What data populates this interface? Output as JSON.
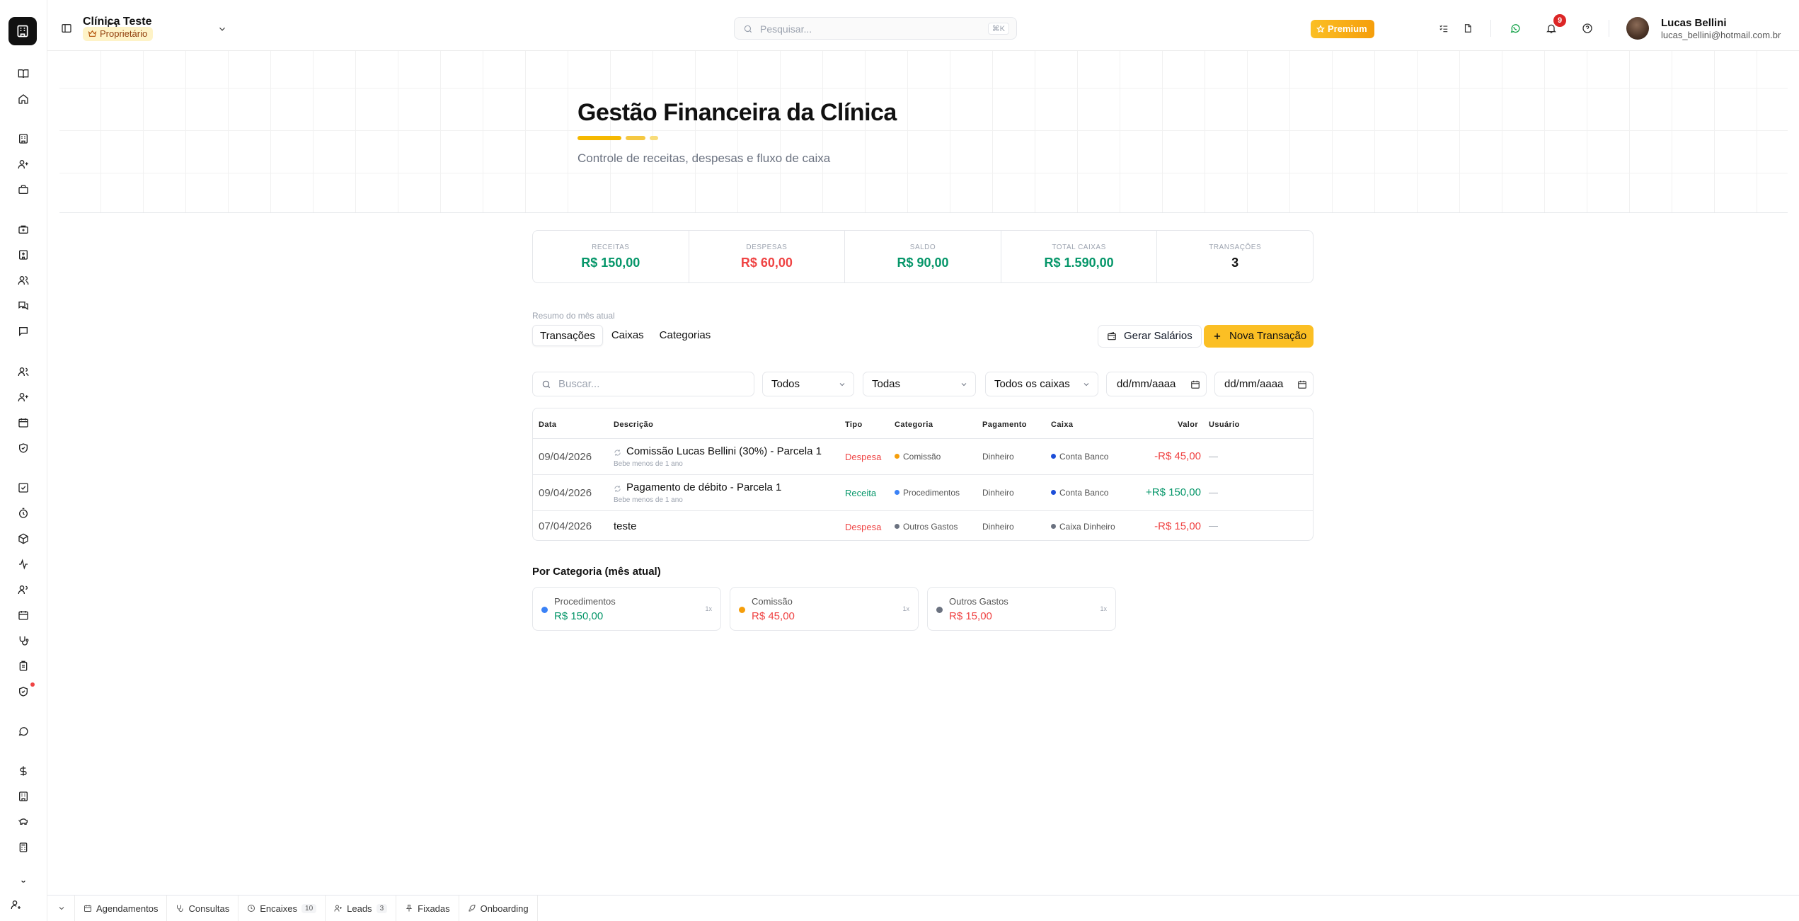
{
  "header": {
    "clinic_name": "Clínica Teste",
    "role": "Proprietário",
    "search_placeholder": "Pesquisar...",
    "search_shortcut": "⌘K",
    "premium_label": "Premium",
    "notification_count": "9",
    "user_name": "Lucas Bellini",
    "user_email": "lucas_bellini@hotmail.com.br"
  },
  "hero": {
    "title": "Gestão Financeira da Clínica",
    "subtitle": "Controle de receitas, despesas e fluxo de caixa"
  },
  "stats": [
    {
      "label": "Receitas",
      "value": "R$ 150,00",
      "color": "#059669"
    },
    {
      "label": "Despesas",
      "value": "R$ 60,00",
      "color": "#ef4444"
    },
    {
      "label": "Saldo",
      "value": "R$ 90,00",
      "color": "#059669"
    },
    {
      "label": "Total Caixas",
      "value": "R$ 1.590,00",
      "color": "#059669"
    },
    {
      "label": "Transações",
      "value": "3",
      "color": "#111111"
    }
  ],
  "summary_label": "Resumo do mês atual",
  "tabs": [
    "Transações",
    "Caixas",
    "Categorias"
  ],
  "actions": {
    "generate_salaries": "Gerar Salários",
    "new_transaction": "Nova Transação"
  },
  "filters": {
    "search_placeholder": "Buscar...",
    "type": "Todos",
    "category": "Todas",
    "cashbox": "Todos os caixas",
    "date_from": "dd/mm/aaaa",
    "date_to": "dd/mm/aaaa"
  },
  "table": {
    "columns": [
      "Data",
      "Descrição",
      "Tipo",
      "Categoria",
      "Pagamento",
      "Caixa",
      "Valor",
      "Usuário"
    ],
    "rows": [
      {
        "date": "09/04/2026",
        "description": "Comissão Lucas Bellini (30%) - Parcela 1",
        "subtitle": "Bebe menos de 1 ano",
        "type": "Despesa",
        "type_color": "#ef4444",
        "category": "Comissão",
        "category_color": "#f59e0b",
        "payment": "Dinheiro",
        "cashbox": "Conta Banco",
        "cashbox_color": "#1d4ed8",
        "amount": "-R$ 45,00",
        "amount_color": "#ef4444",
        "user": "—"
      },
      {
        "date": "09/04/2026",
        "description": "Pagamento de débito - Parcela 1",
        "subtitle": "Bebe menos de 1 ano",
        "type": "Receita",
        "type_color": "#059669",
        "category": "Procedimentos",
        "category_color": "#3b82f6",
        "payment": "Dinheiro",
        "cashbox": "Conta Banco",
        "cashbox_color": "#1d4ed8",
        "amount": "+R$ 150,00",
        "amount_color": "#059669",
        "user": "—"
      },
      {
        "date": "07/04/2026",
        "description": "teste",
        "subtitle": "",
        "type": "Despesa",
        "type_color": "#ef4444",
        "category": "Outros Gastos",
        "category_color": "#6b7280",
        "payment": "Dinheiro",
        "cashbox": "Caixa Dinheiro",
        "cashbox_color": "#6b7280",
        "amount": "-R$ 15,00",
        "amount_color": "#ef4444",
        "user": "—"
      }
    ]
  },
  "by_category": {
    "title": "Por Categoria (mês atual)",
    "items": [
      {
        "name": "Procedimentos",
        "amount": "R$ 150,00",
        "count": "1x",
        "color": "#3b82f6",
        "amount_color": "#059669"
      },
      {
        "name": "Comissão",
        "amount": "R$ 45,00",
        "count": "1x",
        "color": "#f59e0b",
        "amount_color": "#ef4444"
      },
      {
        "name": "Outros Gastos",
        "amount": "R$ 15,00",
        "count": "1x",
        "color": "#6b7280",
        "amount_color": "#ef4444"
      }
    ]
  },
  "bottom_bar": {
    "items": [
      {
        "label": "Agendamentos",
        "count": ""
      },
      {
        "label": "Consultas",
        "count": ""
      },
      {
        "label": "Encaixes",
        "count": "10"
      },
      {
        "label": "Leads",
        "count": "3"
      },
      {
        "label": "Fixadas",
        "count": ""
      },
      {
        "label": "Onboarding",
        "count": ""
      }
    ]
  }
}
